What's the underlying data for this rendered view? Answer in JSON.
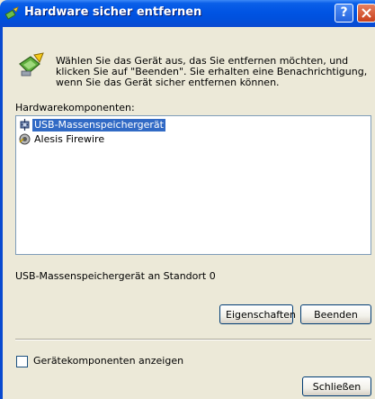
{
  "window": {
    "title": "Hardware sicher entfernen",
    "help_label": "?"
  },
  "intro": {
    "text": "Wählen Sie das Gerät aus, das Sie entfernen möchten, und klicken Sie auf \"Beenden\". Sie erhalten eine Benachrichtigung, wenn Sie das Gerät sicher entfernen können."
  },
  "components": {
    "label": "Hardwarekomponenten:",
    "items": [
      {
        "label": "USB-Massenspeichergerät",
        "icon": "usb-icon",
        "selected": true
      },
      {
        "label": "Alesis Firewire",
        "icon": "firewire-icon",
        "selected": false
      }
    ]
  },
  "status": {
    "text": "USB-Massenspeichergerät an Standort 0"
  },
  "buttons": {
    "properties": "Eigenschaften",
    "stop": "Beenden",
    "close": "Schließen"
  },
  "options": {
    "show_components_label": "Gerätekomponenten anzeigen",
    "show_components_checked": false
  },
  "colors": {
    "titlebar": "#0054e3",
    "selection": "#316ac5",
    "dialog_bg": "#ece9d8"
  }
}
